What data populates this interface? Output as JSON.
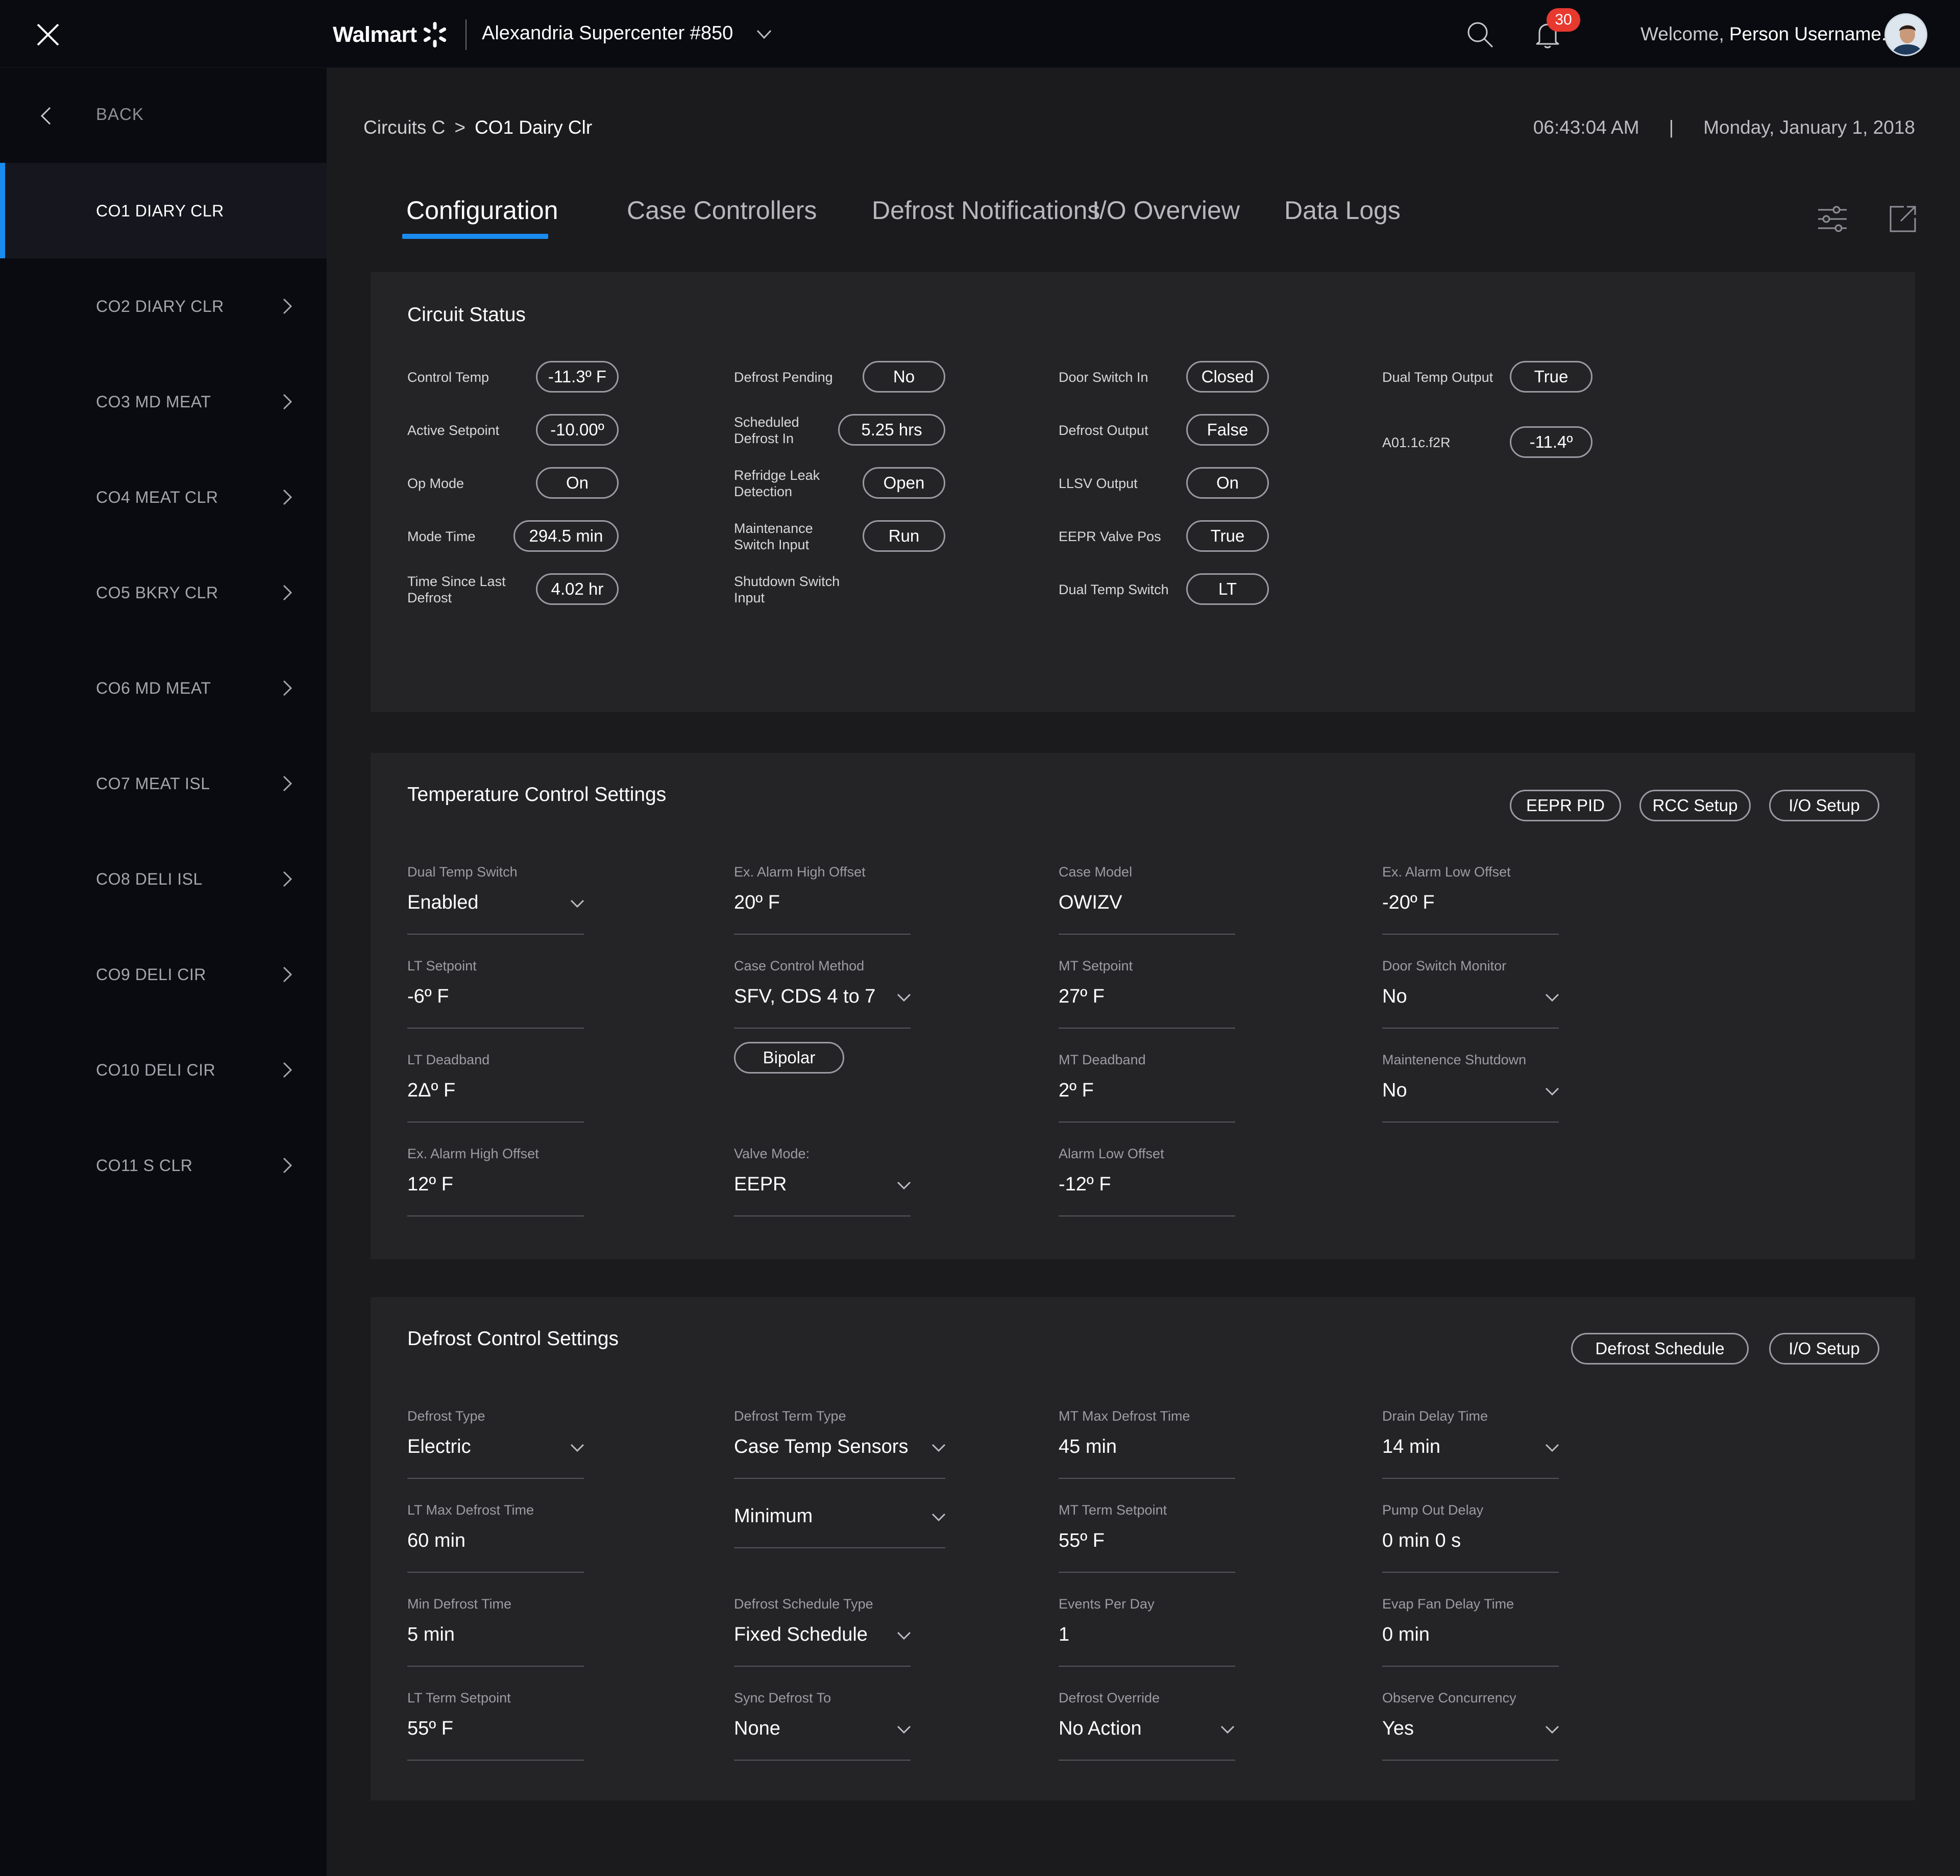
{
  "header": {
    "brand": "Walmart",
    "store": "Alexandria Supercenter #850",
    "notification_count": "30",
    "welcome": "Welcome,",
    "username": "Person Username."
  },
  "sidebar": {
    "back_label": "BACK",
    "items": [
      {
        "label": "CO1 DIARY CLR"
      },
      {
        "label": "CO2 DIARY CLR"
      },
      {
        "label": "CO3 MD MEAT"
      },
      {
        "label": "CO4 MEAT CLR"
      },
      {
        "label": "CO5 BKRY CLR"
      },
      {
        "label": "CO6 MD MEAT"
      },
      {
        "label": "CO7 MEAT ISL"
      },
      {
        "label": "CO8 DELI ISL"
      },
      {
        "label": "CO9 DELI CIR"
      },
      {
        "label": "CO10 DELI CIR"
      },
      {
        "label": "CO11 S CLR"
      }
    ]
  },
  "breadcrumb": {
    "parent": "Circuits C",
    "separator": ">",
    "current": "CO1 Dairy Clr"
  },
  "clock": {
    "time": "06:43:04 AM",
    "separator": "|",
    "date": "Monday, January 1, 2018"
  },
  "tabs": [
    "Configuration",
    "Case Controllers",
    "Defrost Notifications",
    "I/O Overview",
    "Data Logs"
  ],
  "circuit_status": {
    "title": "Circuit Status",
    "col1": [
      {
        "label": "Control Temp",
        "value": "-11.3º F"
      },
      {
        "label": "Active Setpoint",
        "value": "-10.00º"
      },
      {
        "label": "Op Mode",
        "value": "On"
      },
      {
        "label": "Mode Time",
        "value": "294.5 min"
      },
      {
        "label": "Time Since Last Defrost",
        "value": "4.02 hr"
      }
    ],
    "col2": [
      {
        "label": "Defrost Pending",
        "value": "No"
      },
      {
        "label": "Scheduled Defrost In",
        "value": "5.25 hrs"
      },
      {
        "label": "Refridge Leak Detection",
        "value": "Open"
      },
      {
        "label": "Maintenance Switch Input",
        "value": "Run"
      },
      {
        "label": "Shutdown Switch Input",
        "value": ""
      }
    ],
    "col3": [
      {
        "label": "Door Switch In",
        "value": "Closed"
      },
      {
        "label": "Defrost Output",
        "value": "False"
      },
      {
        "label": "LLSV Output",
        "value": "On"
      },
      {
        "label": "EEPR Valve Pos",
        "value": "True"
      },
      {
        "label": "Dual Temp Switch",
        "value": "LT"
      }
    ],
    "col4": [
      {
        "label": "Dual Temp Output",
        "value": "True"
      },
      {
        "label": "A01.1c.f2R",
        "value": "-11.4º"
      }
    ]
  },
  "temp_control": {
    "title": "Temperature Control Settings",
    "buttons": [
      "EEPR PID",
      "RCC Setup",
      "I/O Setup"
    ],
    "fields": [
      {
        "label": "Dual Temp Switch",
        "value": "Enabled"
      },
      {
        "label": "Ex. Alarm High Offset",
        "value": "20º F"
      },
      {
        "label": "Case Model",
        "value": "OWIZV"
      },
      {
        "label": "Ex. Alarm Low Offset",
        "value": "-20º F"
      },
      {
        "label": "LT Setpoint",
        "value": "-6º F"
      },
      {
        "label": "Case Control Method",
        "value": "SFV, CDS 4 to 7"
      },
      {
        "label": "MT Setpoint",
        "value": "27º F"
      },
      {
        "label": "Door Switch Monitor",
        "value": "No"
      },
      {
        "label": "LT Deadband",
        "value": "2Δº F"
      },
      {
        "label": "MT Deadband",
        "value": "2º F"
      },
      {
        "label": "Maintenence Shutdown",
        "value": "No"
      },
      {
        "label": "Ex. Alarm High Offset",
        "value": "12º F"
      },
      {
        "label": "Valve Mode:",
        "value": "EEPR"
      },
      {
        "label": "Alarm Low Offset",
        "value": "-12º F"
      }
    ],
    "bipolar_label": "Bipolar"
  },
  "defrost_control": {
    "title": "Defrost Control Settings",
    "buttons": [
      "Defrost Schedule",
      "I/O Setup"
    ],
    "fields": [
      {
        "label": "Defrost Type",
        "value": "Electric"
      },
      {
        "label": "Defrost Term Type",
        "value": "Case Temp Sensors"
      },
      {
        "label": "MT Max Defrost Time",
        "value": "45 min"
      },
      {
        "label": "Drain Delay Time",
        "value": "14 min"
      },
      {
        "label": "LT Max Defrost Time",
        "value": "60 min"
      },
      {
        "label": "",
        "value": "Minimum"
      },
      {
        "label": "MT Term Setpoint",
        "value": "55º F"
      },
      {
        "label": "Pump Out Delay",
        "value": "0 min 0 s"
      },
      {
        "label": "Min Defrost Time",
        "value": "5 min"
      },
      {
        "label": "Defrost Schedule Type",
        "value": "Fixed Schedule"
      },
      {
        "label": "Events Per Day",
        "value": "1"
      },
      {
        "label": "Evap Fan Delay Time",
        "value": "0 min"
      },
      {
        "label": "LT Term Setpoint",
        "value": "55º F"
      },
      {
        "label": "Sync Defrost To",
        "value": "None"
      },
      {
        "label": "Defrost Override",
        "value": "No Action"
      },
      {
        "label": "Observe Concurrency",
        "value": "Yes"
      }
    ]
  },
  "colors": {
    "accent": "#1a8bef",
    "badge": "#e8392f",
    "panel": "#242427",
    "main_bg": "#1b1b1e",
    "nav_bg": "#0a0b11"
  }
}
